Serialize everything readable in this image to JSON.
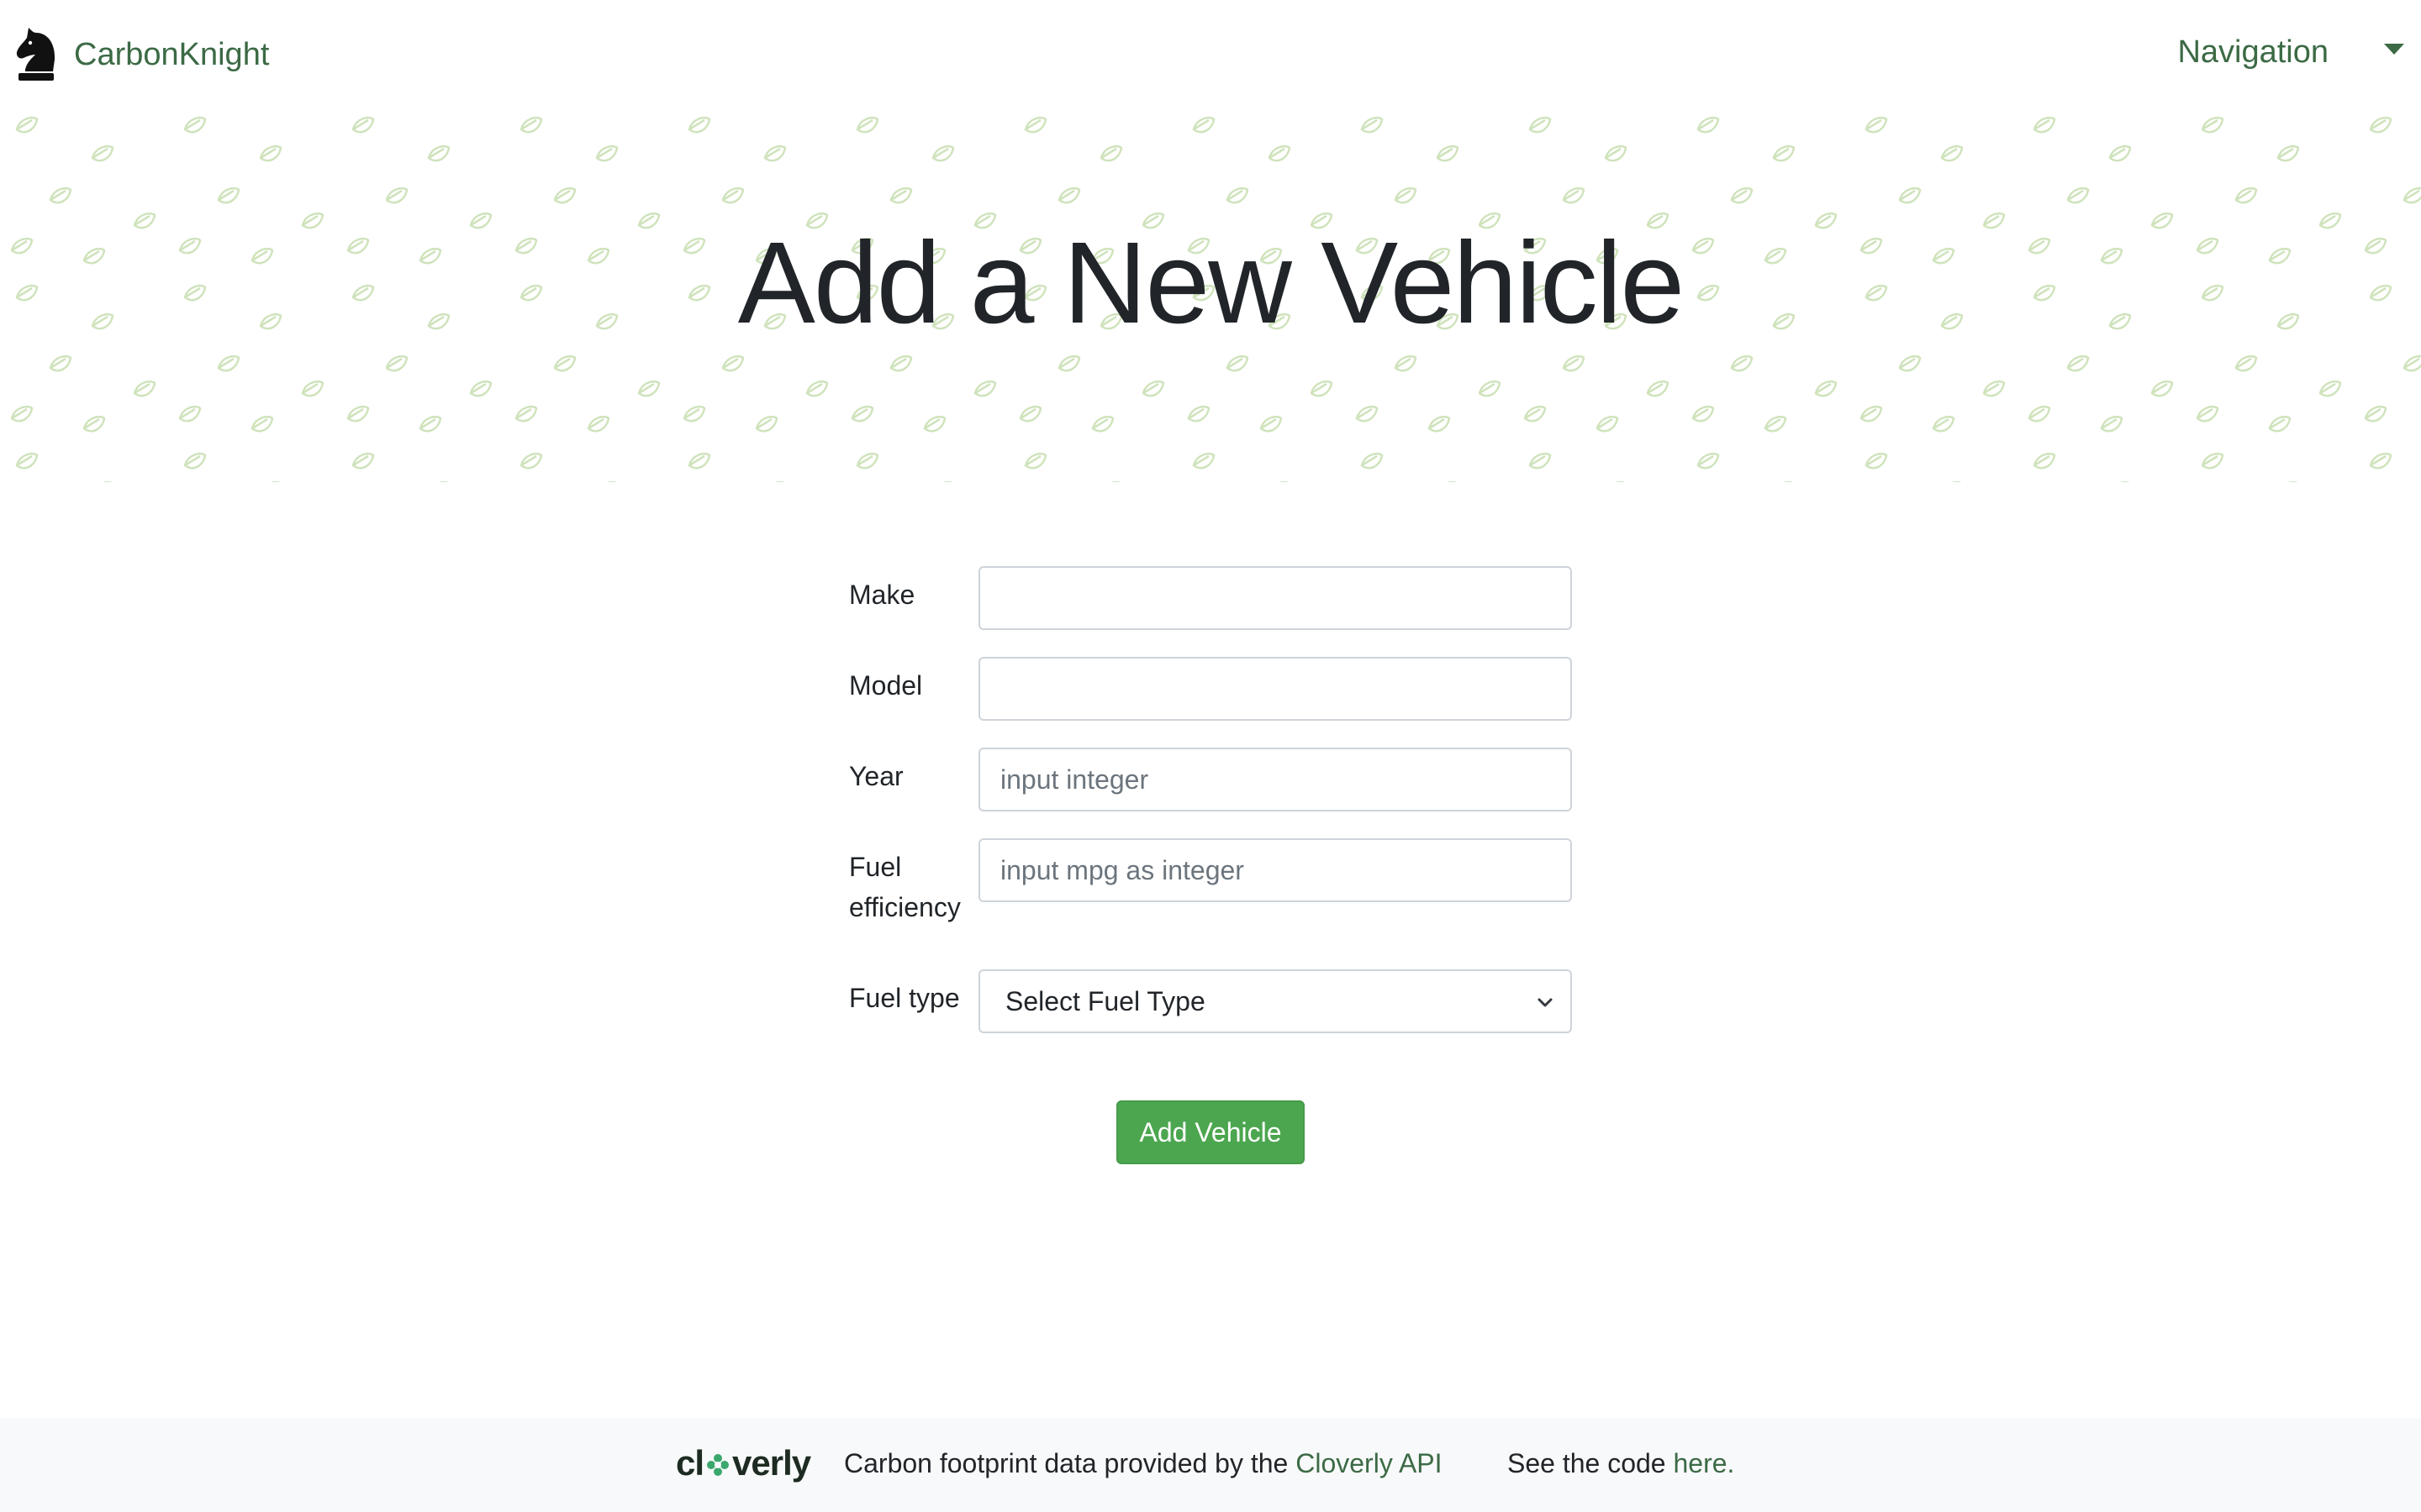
{
  "navbar": {
    "brand_label": "CarbonKnight",
    "brand_icon": "chess-knight-icon",
    "nav_label": "Navigation",
    "caret_icon": "caret-down-icon"
  },
  "hero": {
    "title": "Add a New Vehicle",
    "background_pattern": "leaf-pattern"
  },
  "form": {
    "make": {
      "label": "Make",
      "value": "",
      "placeholder": ""
    },
    "model": {
      "label": "Model",
      "value": "",
      "placeholder": ""
    },
    "year": {
      "label": "Year",
      "value": "",
      "placeholder": "input integer"
    },
    "fuel_efficiency": {
      "label": "Fuel efficiency",
      "value": "",
      "placeholder": "input mpg as integer"
    },
    "fuel_type": {
      "label": "Fuel type",
      "selected": "Select Fuel Type"
    },
    "submit_label": "Add Vehicle"
  },
  "footer": {
    "logo_prefix": "cl",
    "logo_suffix": "verly",
    "data_text_prefix": "Carbon footprint data provided by the ",
    "data_link": "Cloverly API",
    "code_text_prefix": "See the code ",
    "code_link": "here",
    "code_text_suffix": "."
  },
  "colors": {
    "brand_green": "#3c6a45",
    "button_green": "#4ca64f",
    "leaf_pattern": "#cfe3bc",
    "footer_bg": "#f8f9fa"
  }
}
